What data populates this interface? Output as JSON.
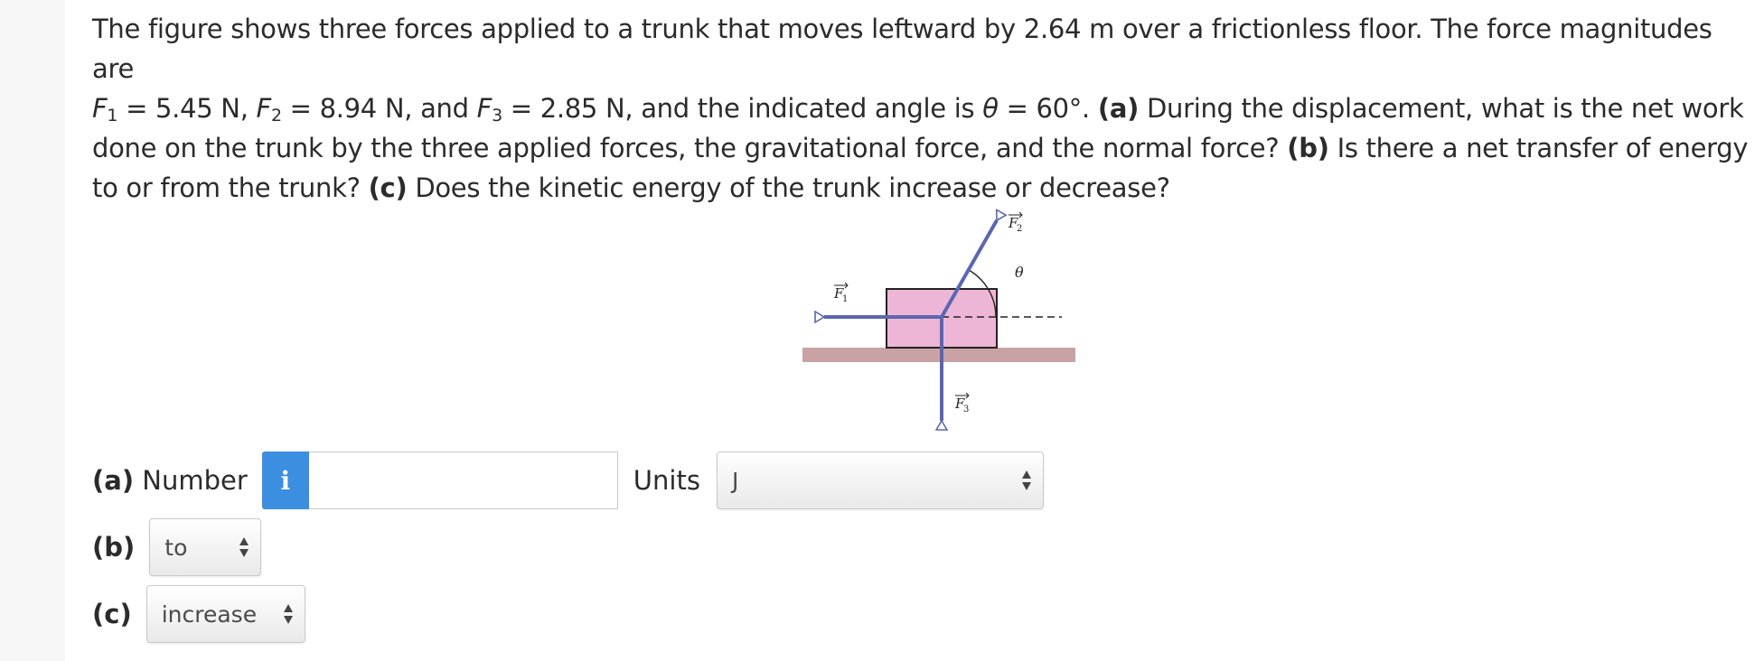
{
  "question": {
    "intro": "The figure shows three forces applied to a trunk that moves leftward by 2.64 m over a frictionless floor. The force magnitudes are",
    "f1_sym": "F",
    "f1_sub": "1",
    "f1_val": " = 5.45 N, ",
    "f2_sym": "F",
    "f2_sub": "2",
    "f2_val": " = 8.94 N, and ",
    "f3_sym": "F",
    "f3_sub": "3",
    "f3_val": " = 2.85 N, and the indicated angle is ",
    "theta_sym": "θ",
    "theta_val": " = 60°. ",
    "part_a_tag": "(a)",
    "part_a_text": " During the displacement, what is the net work done on the trunk by the three applied forces, the gravitational force, and the normal force? ",
    "part_b_tag": "(b)",
    "part_b_text": " Is there a net transfer of energy to or from the trunk? ",
    "part_c_tag": "(c)",
    "part_c_text": " Does the kinetic energy of the trunk increase or decrease?"
  },
  "figure": {
    "label_f1": "F1",
    "label_f2": "F2",
    "label_f3": "F3",
    "label_theta": "θ",
    "colors": {
      "trunk": "#eeb6d6",
      "floor": "#c9a3a3",
      "arrow": "#5b66b0"
    }
  },
  "answers": {
    "a": {
      "tag": "(a)",
      "label": " Number",
      "info_icon": "i",
      "value": "",
      "units_label": "Units",
      "units_value": "J"
    },
    "b": {
      "tag": "(b)",
      "value": "to"
    },
    "c": {
      "tag": "(c)",
      "value": "increase"
    }
  }
}
